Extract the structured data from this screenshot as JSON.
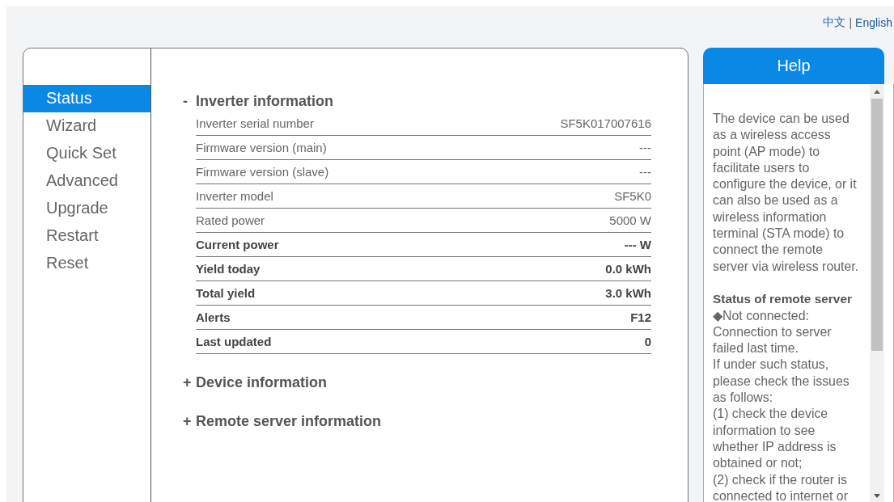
{
  "language_links": [
    {
      "label": "中文",
      "selected": false
    },
    {
      "label": "English",
      "selected": true
    }
  ],
  "language_separator": "|",
  "sidebar": {
    "items": [
      {
        "label": "Status",
        "selected": true
      },
      {
        "label": "Wizard",
        "selected": false
      },
      {
        "label": "Quick Set",
        "selected": false
      },
      {
        "label": "Advanced",
        "selected": false
      },
      {
        "label": "Upgrade",
        "selected": false
      },
      {
        "label": "Restart",
        "selected": false
      },
      {
        "label": "Reset",
        "selected": false
      }
    ]
  },
  "sections": [
    {
      "marker": "-",
      "title": "Inverter information",
      "rows": [
        {
          "label": "Inverter serial number",
          "value": "SF5K017007616",
          "bold": false
        },
        {
          "label": "Firmware version (main)",
          "value": "---",
          "bold": false
        },
        {
          "label": "Firmware version (slave)",
          "value": "---",
          "bold": false
        },
        {
          "label": "Inverter model",
          "value": "SF5K0",
          "bold": false
        },
        {
          "label": "Rated power",
          "value": "5000 W",
          "bold": false
        },
        {
          "label": "Current power",
          "value": "--- W",
          "bold": true
        },
        {
          "label": "Yield today",
          "value": "0.0 kWh",
          "bold": true
        },
        {
          "label": "Total yield",
          "value": "3.0 kWh",
          "bold": true
        },
        {
          "label": "Alerts",
          "value": "F12",
          "bold": true
        },
        {
          "label": "Last updated",
          "value": "0",
          "bold": true
        }
      ]
    },
    {
      "marker": "+",
      "title": "Device information"
    },
    {
      "marker": "+",
      "title": "Remote server information"
    }
  ],
  "help": {
    "title": "Help",
    "blocks": [
      {
        "kind": "paragraph",
        "text": "The device can be used as a wireless access point (AP mode) to facilitate users to configure the device, or it can also be used as a wireless information terminal (STA mode) to connect the remote server via wireless router."
      },
      {
        "kind": "heading",
        "text": "Status of remote server"
      },
      {
        "kind": "line",
        "text": "◆Not connected: Connection to server failed last time."
      },
      {
        "kind": "line",
        "text": "If under such status, please check the issues as follows:"
      },
      {
        "kind": "line",
        "text": "(1) check the device information to see whether IP address is obtained or not;"
      },
      {
        "kind": "line",
        "text": "(2) check if the router is connected to internet or"
      }
    ]
  }
}
